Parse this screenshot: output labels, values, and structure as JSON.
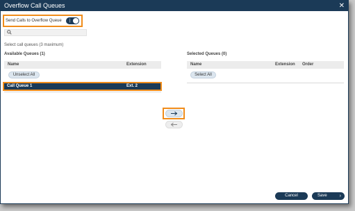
{
  "dialog": {
    "title": "Overflow Call Queues",
    "toggle_label": "Send Calls to Overflow Queue",
    "toggle_state": "on",
    "search_placeholder": "",
    "hint": "Select call queues (3 maximum)"
  },
  "available": {
    "title": "Available Queues (1)",
    "col_name": "Name",
    "col_extension": "Extension",
    "unselect_all": "Unselect All",
    "rows": [
      {
        "name": "Call Queue 1",
        "extension": "Ext. 2",
        "selected": true
      }
    ]
  },
  "selected": {
    "title": "Selected Queues (0)",
    "col_name": "Name",
    "col_extension": "Extension",
    "col_order": "Order",
    "select_all": "Select All",
    "rows": []
  },
  "footer": {
    "cancel": "Cancel",
    "save": "Save"
  },
  "colors": {
    "primary": "#1b3a57",
    "highlight": "#f08c1a"
  },
  "icons": {
    "close": "close-icon",
    "search": "search-icon",
    "move_right": "arrow-right-icon",
    "move_left": "arrow-left-icon",
    "save_chevron": "chevron-right-icon"
  }
}
